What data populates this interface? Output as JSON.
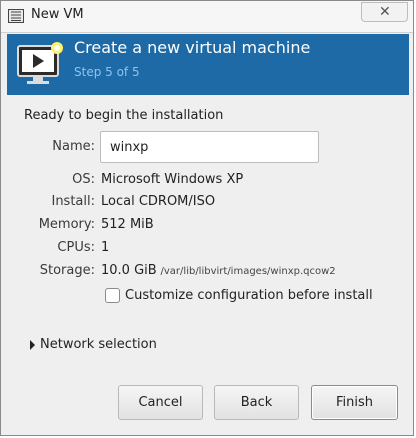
{
  "window": {
    "title": "New VM",
    "close_symbol": "✕"
  },
  "header": {
    "title": "Create a new virtual machine",
    "step": "Step 5 of 5"
  },
  "summary": {
    "heading": "Ready to begin the installation",
    "name_label": "Name:",
    "name_value": "winxp",
    "os_label": "OS:",
    "os_value": "Microsoft Windows XP",
    "install_label": "Install:",
    "install_value": "Local CDROM/ISO",
    "memory_label": "Memory:",
    "memory_value": "512 MiB",
    "cpus_label": "CPUs:",
    "cpus_value": "1",
    "storage_label": "Storage:",
    "storage_size": "10.0 GiB",
    "storage_path": "/var/lib/libvirt/images/winxp.qcow2",
    "customize_label": "Customize configuration before install",
    "customize_checked": false
  },
  "network": {
    "label": "Network selection",
    "expanded": false
  },
  "buttons": {
    "cancel": "Cancel",
    "back": "Back",
    "finish": "Finish"
  },
  "colors": {
    "header_bg": "#1e6aa6",
    "step_text": "#8ec3ee"
  }
}
